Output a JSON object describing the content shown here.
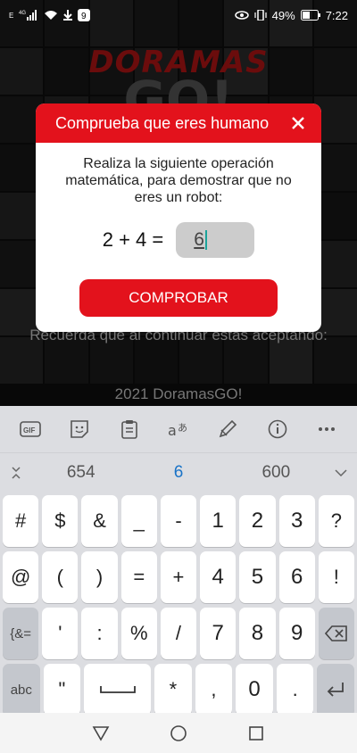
{
  "status_bar": {
    "left_icons": [
      "carrier-e-icon",
      "signal-4g-icon",
      "wifi-icon",
      "download-icon",
      "app-notification-icon"
    ],
    "eye_icon": "eye-icon",
    "vibrate_icon": "vibrate-icon",
    "battery": "49%",
    "time": "7:22"
  },
  "background": {
    "logo_text": "DORAMAS",
    "logo_sub": "GO!",
    "remember_text": "Recuerda que al continuar estas aceptando:",
    "footer_text": "2021 DoramasGO!"
  },
  "modal": {
    "title": "Comprueba que eres humano",
    "description": "Realiza la siguiente operación matemática, para demostrar que no eres un robot:",
    "expression": "2 + 4 =",
    "answer_value": "6",
    "submit_label": "COMPROBAR",
    "accent_color": "#e3121c"
  },
  "keyboard": {
    "toolbar": [
      "gif-icon",
      "sticker-icon",
      "clipboard-icon",
      "translate-icon",
      "handwriting-icon",
      "info-icon",
      "more-icon"
    ],
    "gif_label": "GIF",
    "suggestions": [
      "654",
      "6",
      "600"
    ],
    "rows": [
      [
        "#",
        "$",
        "&",
        "_",
        "-",
        "1",
        "2",
        "3",
        "?"
      ],
      [
        "@",
        "(",
        ")",
        "=",
        "+",
        "4",
        "5",
        "6",
        "!"
      ],
      [
        "{&=",
        "'",
        ":",
        "%",
        "/",
        "7",
        "8",
        "9",
        "⌫"
      ],
      [
        "abc",
        "\"",
        "⎵",
        "*",
        ",",
        "0",
        ".",
        "↵"
      ]
    ]
  },
  "nav_bar": [
    "back-icon",
    "home-icon",
    "recents-icon"
  ]
}
